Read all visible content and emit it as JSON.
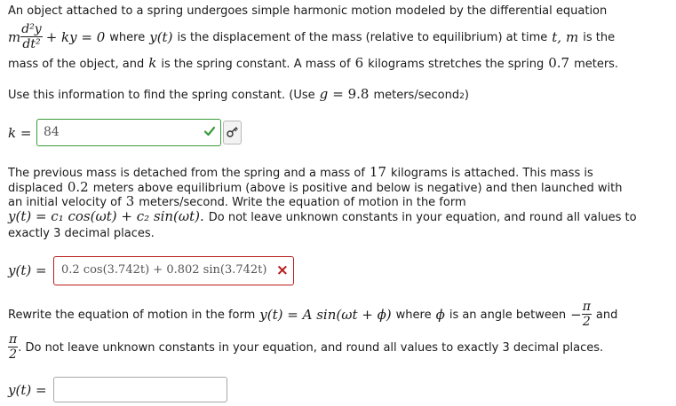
{
  "part1": {
    "line1": "An object attached to a spring undergoes simple harmonic motion modeled by the differential equation",
    "eq_m": "m",
    "eq_num": "d²y",
    "eq_den": "dt²",
    "eq_rest": "+ ky = 0",
    "line2_a": "where",
    "line2_yt": "y(t)",
    "line2_b": "is the displacement of the mass (relative to equilibrium) at time",
    "line2_t": "t,",
    "line2_m": "m",
    "line2_c": "is the",
    "line3_a": "mass of the object, and",
    "line3_k": "k",
    "line3_b": "is the spring constant. A mass of",
    "line3_6": "6",
    "line3_c": "kilograms stretches the spring",
    "line3_07": "0.7",
    "line3_d": "meters.",
    "line4_a": "Use this information to find the spring constant. (Use",
    "line4_g": "g",
    "line4_eq": "= 9.8",
    "line4_b": "meters/second",
    "line4_sup": "2",
    "line4_c": ")"
  },
  "answer1": {
    "label": "k =",
    "value": "84",
    "status_icon": "check-icon",
    "key_icon": "key-icon"
  },
  "part2": {
    "line1": "The previous mass is detached from the spring and a mass of",
    "mass": "17",
    "line1b": "kilograms is attached. This mass is",
    "line2a": "displaced",
    "disp": "0.2",
    "line2b": "meters above equilibrium (above is positive and below is negative) and then launched with",
    "line3a": "an initial velocity of",
    "vel": "3",
    "line3b": "meters/second. Write the equation of motion in the form",
    "form": "y(t) = c₁ cos(ωt) + c₂ sin(ωt).",
    "line4b": "Do not leave unknown constants in your equation, and round all values to",
    "line5": "exactly 3 decimal places."
  },
  "answer2": {
    "label": "y(t) =",
    "value": "0.2 cos(3.742t) + 0.802 sin(3.742t)",
    "status_icon": "cross-icon",
    "status_glyph": "×"
  },
  "part3": {
    "line1a": "Rewrite the equation of motion in the form",
    "form": "y(t) = A sin(ωt + ϕ)",
    "line1b": "where",
    "phi": "ϕ",
    "line1c": "is an angle between",
    "neg": "−",
    "pi_num": "π",
    "pi_den": "2",
    "and": "and",
    "line2b": ". Do not leave unknown constants in your equation, and round all values to exactly 3 decimal places."
  },
  "answer3": {
    "label": "y(t) =",
    "value": ""
  },
  "colors": {
    "correct": "#3b9a3b",
    "incorrect": "#b91c1c"
  }
}
